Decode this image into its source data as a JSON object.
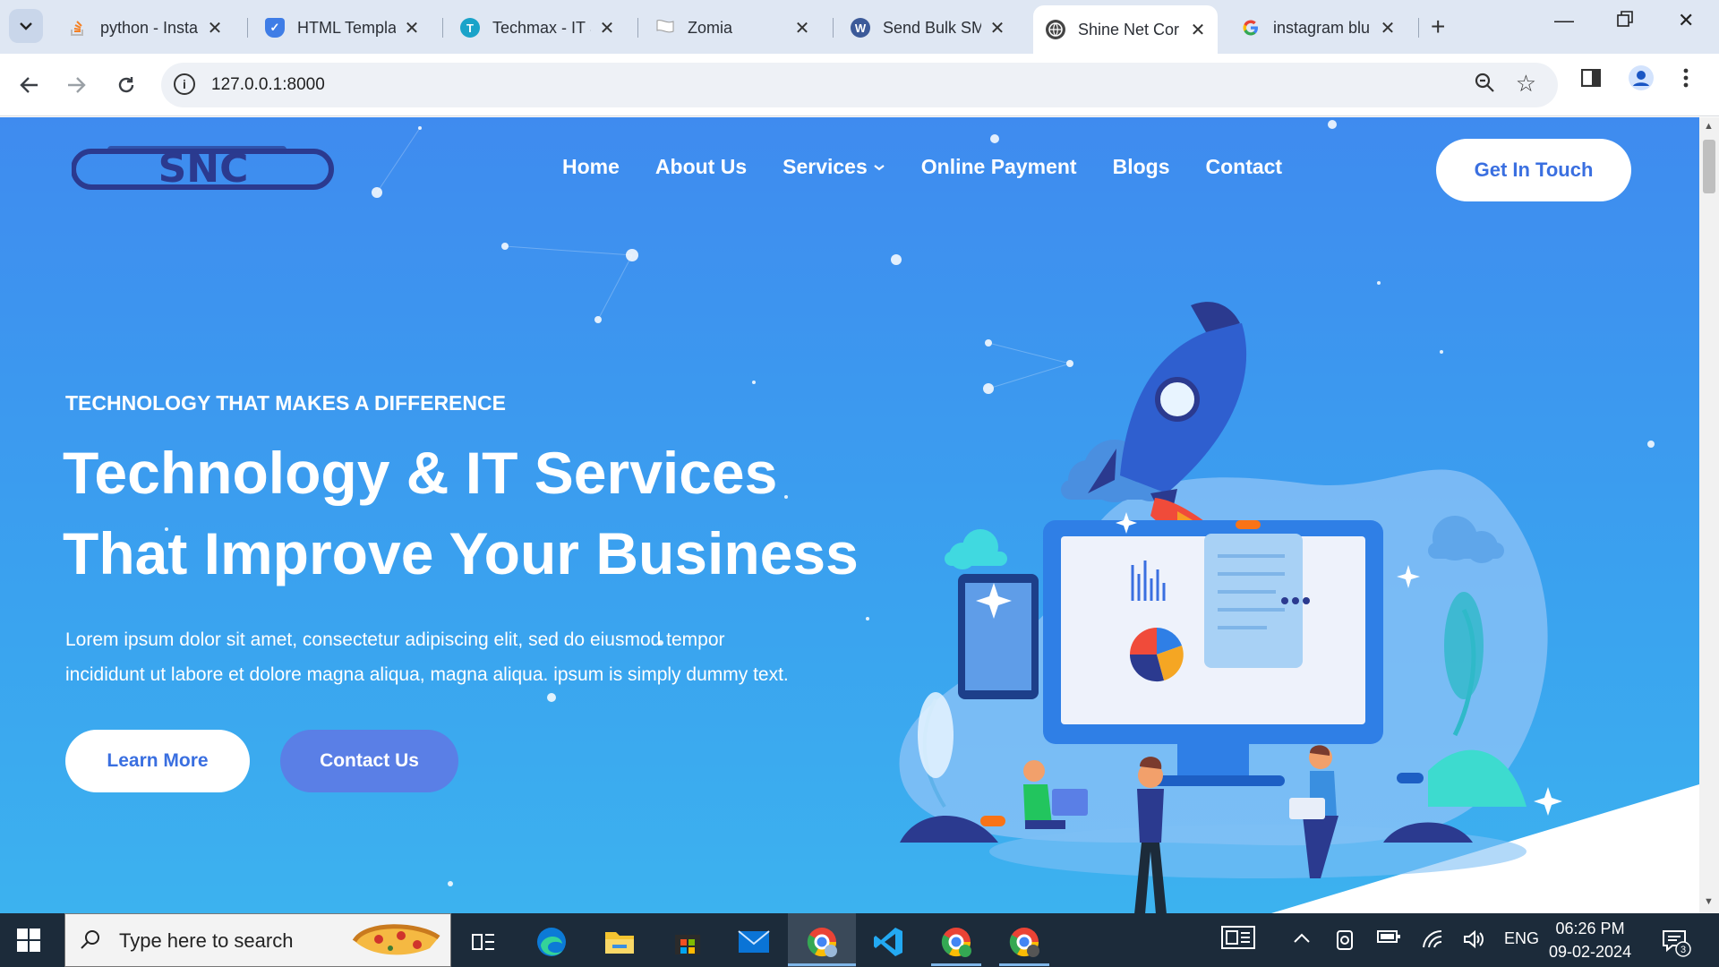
{
  "browser": {
    "tabs": [
      {
        "title": "python - Insta",
        "favicon": "stackoverflow-icon",
        "color": "#f48024",
        "active": false
      },
      {
        "title": "HTML Templat",
        "favicon": "shield-icon",
        "color": "#3f7de6",
        "active": false
      },
      {
        "title": "Techmax - IT S",
        "favicon": "t-badge-icon",
        "color": "#1aa3c9",
        "active": false
      },
      {
        "title": "Zomia",
        "favicon": "flag-icon",
        "color": "#ffffff",
        "active": false
      },
      {
        "title": "Send Bulk SM",
        "favicon": "wordpress-icon",
        "color": "#3c5a99",
        "active": false
      },
      {
        "title": "Shine Net Cor",
        "favicon": "globe-icon",
        "color": "#444444",
        "active": true
      },
      {
        "title": "instagram blu",
        "favicon": "google-icon",
        "color": "#4285f4",
        "active": false
      }
    ],
    "url": "127.0.0.1:8000"
  },
  "site": {
    "logo_text": "SNC",
    "nav": [
      "Home",
      "About Us",
      "Services",
      "Online Payment",
      "Blogs",
      "Contact"
    ],
    "cta": "Get In Touch",
    "eyebrow": "TECHNOLOGY THAT MAKES A DIFFERENCE",
    "headline_line1": "Technology & IT Services",
    "headline_line2": "That Improve Your Business",
    "lede_line1": "Lorem ipsum dolor sit amet, consectetur adipiscing elit, sed do eiusmod tempor",
    "lede_line2": "incididunt ut labore et dolore magna aliqua, magna aliqua. ipsum is simply dummy text.",
    "btn_learn": "Learn More",
    "btn_contact": "Contact Us",
    "colors": {
      "accent": "#3a6fe0",
      "hero_bg": "#3f8bef",
      "contact_btn": "#5a7fe6"
    }
  },
  "taskbar": {
    "search_placeholder": "Type here to search",
    "lang": "ENG",
    "time": "06:26 PM",
    "date": "09-02-2024",
    "notifications": "3"
  }
}
